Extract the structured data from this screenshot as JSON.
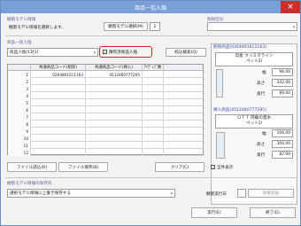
{
  "title": "商品一括入換",
  "icons": {
    "close": "×",
    "dropdown": "▾",
    "check": "✓"
  },
  "colors": {
    "titlebar": "#7a9fd8",
    "close": "#c9302c",
    "highlight": "#e02020",
    "label": "#6a5a9c"
  },
  "top": {
    "shelf_model_label": "棚割モデル情報",
    "shelf_model_text": "棚割モデル情報を選択します。",
    "shelf_model_button": "棚割モデル選択(M)",
    "shelf_model_value": "1",
    "delete_category_label": "削除区分",
    "delete_category_value": ""
  },
  "products": {
    "section_label": "商品一括入換",
    "mode_value": "商品入換(1対1)",
    "toggle_label": "陳列済商品入換",
    "toggle_checked": true,
    "search_button": "絞込検索(Q)"
  },
  "grid": {
    "headers": [
      "",
      "共通商品コード(削除)",
      "共通商品コード(挿入)",
      "ｱｲﾃﾞｨﾂﾞ数"
    ],
    "rows": [
      {
        "no": "1",
        "del": "0264801611163",
        "ins": "4512480777295",
        "qty": ""
      },
      {
        "no": "2",
        "del": "",
        "ins": "",
        "qty": ""
      },
      {
        "no": "3",
        "del": "",
        "ins": "",
        "qty": ""
      },
      {
        "no": "4",
        "del": "",
        "ins": "",
        "qty": ""
      },
      {
        "no": "5",
        "del": "",
        "ins": "",
        "qty": ""
      },
      {
        "no": "6",
        "del": "",
        "ins": "",
        "qty": ""
      },
      {
        "no": "7",
        "del": "",
        "ins": "",
        "qty": ""
      },
      {
        "no": "8",
        "del": "",
        "ins": "",
        "qty": ""
      },
      {
        "no": "9",
        "del": "",
        "ins": "",
        "qty": ""
      },
      {
        "no": "10",
        "del": "",
        "ins": "",
        "qty": ""
      },
      {
        "no": "11",
        "del": "",
        "ins": "",
        "qty": ""
      },
      {
        "no": "12",
        "del": "",
        "ins": "",
        "qty": ""
      }
    ]
  },
  "deleted_panel": {
    "title": "削除商品(0264801611163)",
    "name": "伝産 クリスタライン\nペット2l",
    "width_label": "幅",
    "width": "96.00",
    "height_label": "高さ",
    "height": "342.00",
    "depth_label": "奥行",
    "depth": "89.00"
  },
  "inserted_panel": {
    "title": "挿入商品(4512480777295)",
    "name": "ＯＴＴ 阿蘇の雲水\nペット2l",
    "width_label": "幅",
    "width": "106.00",
    "height_label": "高さ",
    "height": "306.00",
    "depth_label": "奥行",
    "depth": "87.00"
  },
  "file_buttons": {
    "load": "ファイル読込(R)",
    "save": "ファイル保存(B)",
    "clear": "クリア(C)",
    "show_all": "全件表示"
  },
  "save_section": {
    "label": "棚割モデル情報の保存先",
    "save_mode_value": "選択モデル情報に上書き保存する",
    "update_date_label": "棚割実行日",
    "apply_button": "新規追加"
  },
  "bottom": {
    "execute": "実行(E)",
    "exit": "終了(E)"
  }
}
